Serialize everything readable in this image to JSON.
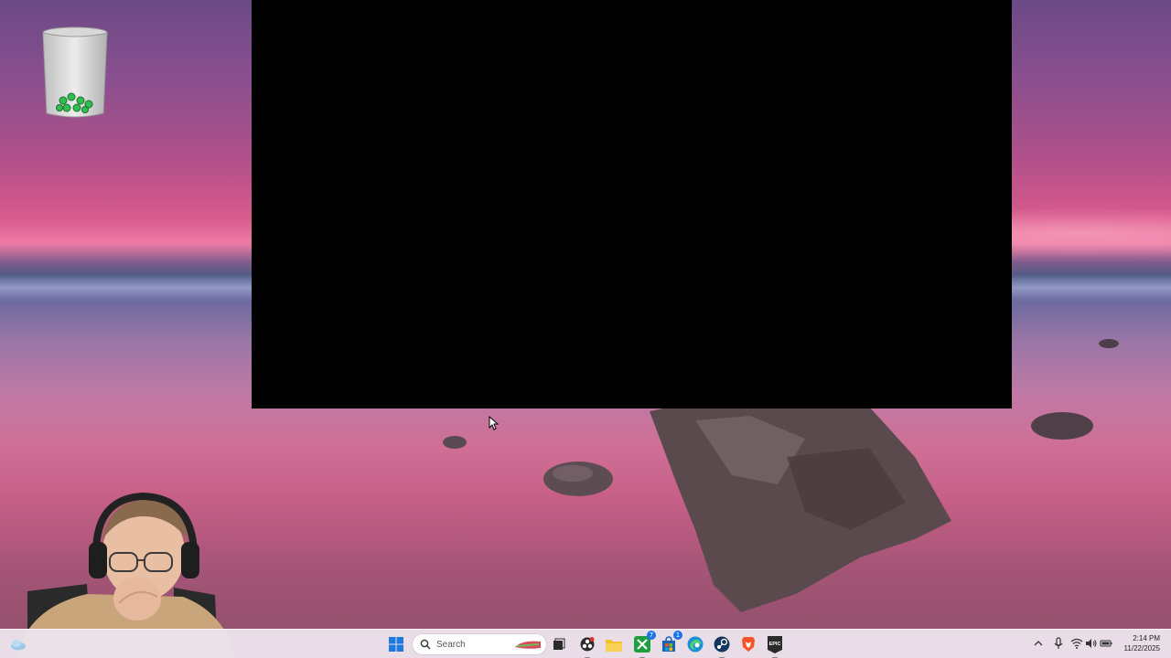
{
  "desktop": {
    "icons": [
      {
        "name": "recycle-bin-icon",
        "label": ""
      }
    ]
  },
  "taskbar": {
    "search": {
      "placeholder": "Search"
    },
    "pinned": [
      {
        "name": "start-button",
        "icon": "windows-logo-icon"
      },
      {
        "name": "search-box",
        "icon": "search-icon"
      },
      {
        "name": "task-view-button",
        "icon": "task-view-icon"
      },
      {
        "name": "obs-button",
        "icon": "obs-icon"
      },
      {
        "name": "file-explorer-button",
        "icon": "folder-icon"
      },
      {
        "name": "xbox-button",
        "icon": "xbox-icon",
        "badge": "7"
      },
      {
        "name": "microsoft-store-button",
        "icon": "store-icon",
        "badge": "1"
      },
      {
        "name": "edge-button",
        "icon": "edge-icon"
      },
      {
        "name": "steam-button",
        "icon": "steam-icon"
      },
      {
        "name": "brave-button",
        "icon": "brave-icon"
      },
      {
        "name": "epic-games-button",
        "icon": "epic-games-icon",
        "text": "EPIC"
      }
    ],
    "tray": {
      "time": "2:14 PM",
      "date": "11/22/2025"
    }
  },
  "colors": {
    "taskbar_bg": "#ece4ec",
    "accent_blue": "#1a73e8",
    "window_black": "#000000"
  }
}
